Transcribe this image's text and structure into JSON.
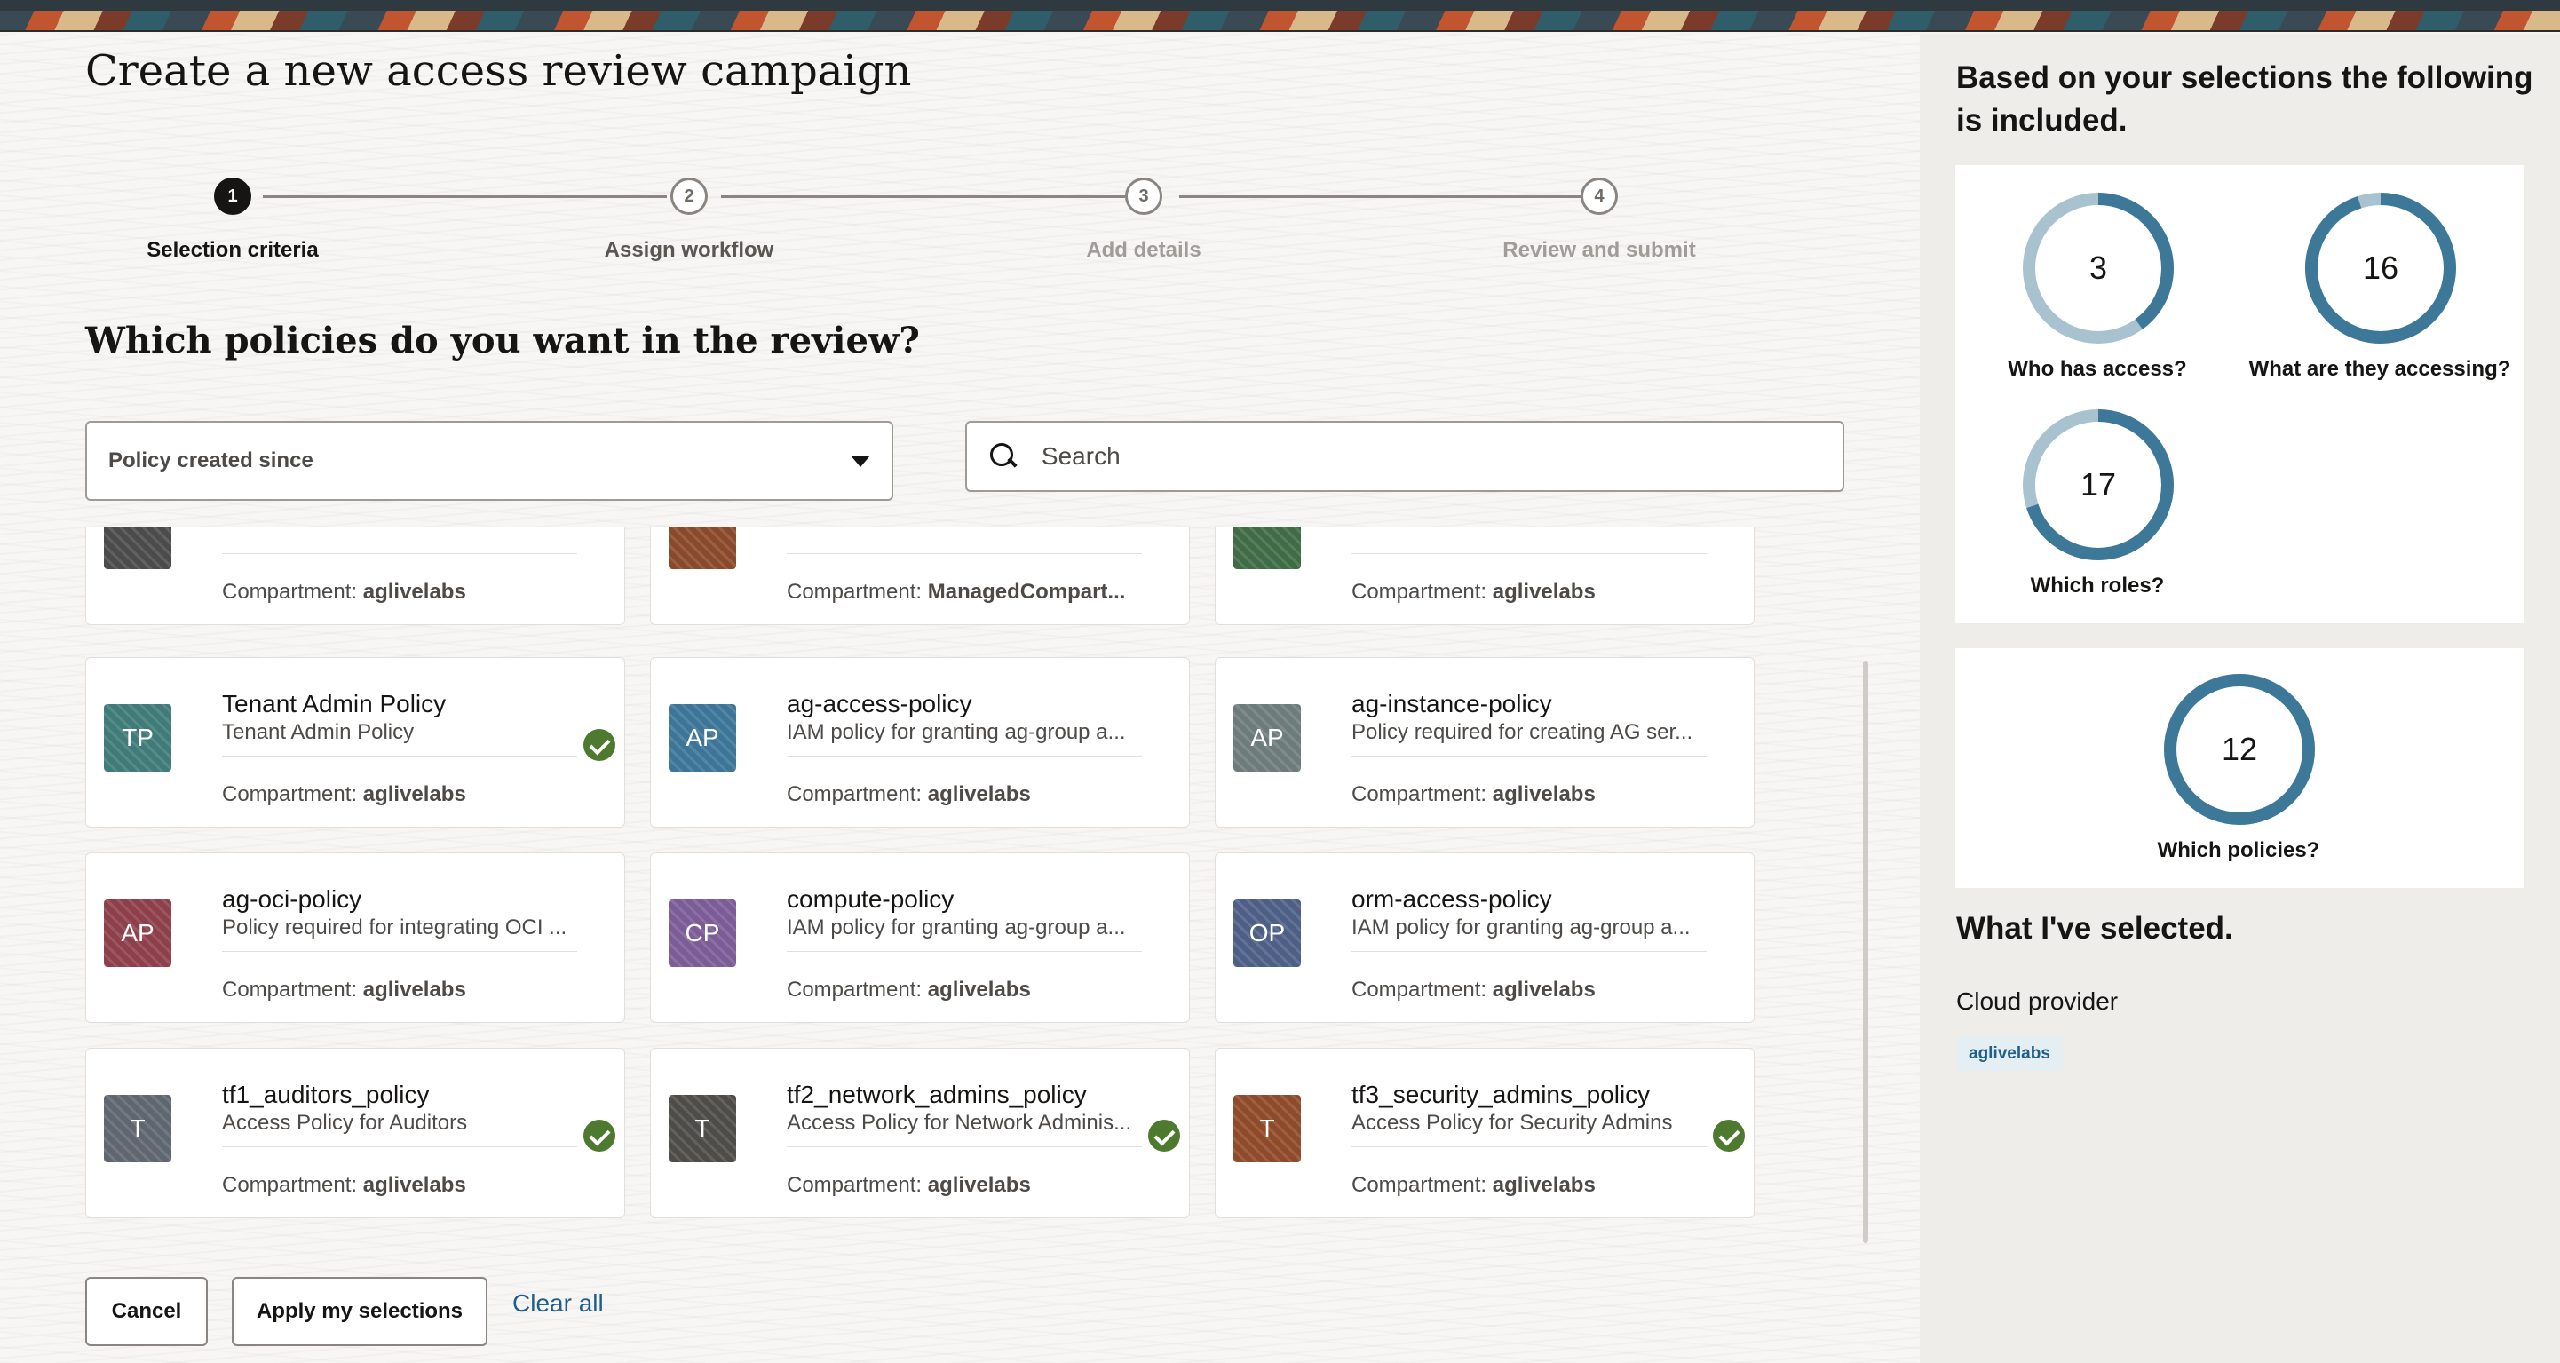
{
  "page": {
    "title": "Create a new access review campaign",
    "question": "Which policies do you want in the review?"
  },
  "steps": [
    {
      "number": "1",
      "label": "Selection criteria",
      "state": "active"
    },
    {
      "number": "2",
      "label": "Assign workflow",
      "state": "upcoming"
    },
    {
      "number": "3",
      "label": "Add details",
      "state": "upcoming"
    },
    {
      "number": "4",
      "label": "Review and submit",
      "state": "upcoming"
    }
  ],
  "filter": {
    "selected": "Policy created since"
  },
  "search": {
    "placeholder": "Search"
  },
  "compartment_label": "Compartment:",
  "cards": [
    {
      "name": "",
      "desc": "",
      "initials": "",
      "compartment": "aglivelabs",
      "selected": false,
      "color": "#4b4b4b"
    },
    {
      "name": "",
      "desc": "",
      "initials": "",
      "compartment": "ManagedCompart...",
      "selected": false,
      "color": "#8a4a2a"
    },
    {
      "name": "",
      "desc": "",
      "initials": "",
      "compartment": "aglivelabs",
      "selected": false,
      "color": "#3f6b45"
    },
    {
      "name": "Tenant Admin Policy",
      "desc": "Tenant Admin Policy",
      "initials": "TP",
      "compartment": "aglivelabs",
      "selected": true,
      "color": "#3f7b78"
    },
    {
      "name": "ag-access-policy",
      "desc": "IAM policy for granting ag-group a...",
      "initials": "AP",
      "compartment": "aglivelabs",
      "selected": false,
      "color": "#3d7598"
    },
    {
      "name": "ag-instance-policy",
      "desc": "Policy required for creating AG ser...",
      "initials": "AP",
      "compartment": "aglivelabs",
      "selected": false,
      "color": "#6d7c7a"
    },
    {
      "name": "ag-oci-policy",
      "desc": "Policy required for integrating OCI ...",
      "initials": "AP",
      "compartment": "aglivelabs",
      "selected": false,
      "color": "#8d3f4a"
    },
    {
      "name": "compute-policy",
      "desc": "IAM policy for granting ag-group a...",
      "initials": "CP",
      "compartment": "aglivelabs",
      "selected": false,
      "color": "#7b5c97"
    },
    {
      "name": "orm-access-policy",
      "desc": "IAM policy for granting ag-group a...",
      "initials": "OP",
      "compartment": "aglivelabs",
      "selected": false,
      "color": "#4e5f86"
    },
    {
      "name": "tf1_auditors_policy",
      "desc": "Access Policy for Auditors",
      "initials": "T",
      "compartment": "aglivelabs",
      "selected": true,
      "color": "#5f6670"
    },
    {
      "name": "tf2_network_admins_policy",
      "desc": "Access Policy for Network Adminis...",
      "initials": "T",
      "compartment": "aglivelabs",
      "selected": true,
      "color": "#4e4c48"
    },
    {
      "name": "tf3_security_admins_policy",
      "desc": "Access Policy for Security Admins",
      "initials": "T",
      "compartment": "aglivelabs",
      "selected": true,
      "color": "#8f4a2a"
    }
  ],
  "footer": {
    "cancel": "Cancel",
    "apply": "Apply my selections",
    "clear": "Clear all"
  },
  "summary": {
    "title": "Based on your selections the following is included.",
    "donuts": [
      {
        "value": "3",
        "label": "Who has access?",
        "fill": 0.4
      },
      {
        "value": "16",
        "label": "What are they accessing?",
        "fill": 0.95
      },
      {
        "value": "17",
        "label": "Which roles?",
        "fill": 0.7
      },
      {
        "value": "12",
        "label": "Which policies?",
        "fill": 1.0
      }
    ],
    "colors": {
      "ring": "#3d7898",
      "track": "#a9c2d0"
    }
  },
  "selected": {
    "title": "What I've selected.",
    "group_label": "Cloud provider",
    "chip": "aglivelabs"
  }
}
